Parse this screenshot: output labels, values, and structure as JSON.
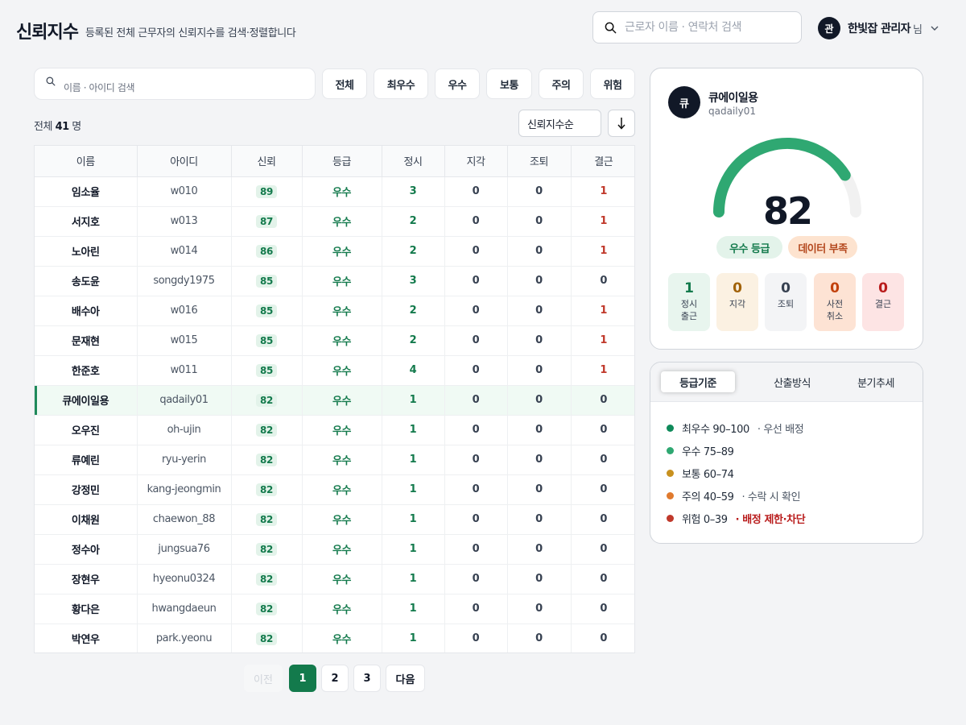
{
  "header": {
    "title": "신뢰지수",
    "subtitle": "등록된 전체 근무자의 신뢰지수를 검색·정렬합니다",
    "search_placeholder": "근로자 이름 · 연락처 검색",
    "user_avatar": "관",
    "user_name": "한빛잡 관리자",
    "user_suffix": "님"
  },
  "filters": {
    "search_placeholder": "이름 · 아이디 검색",
    "buttons": [
      "전체",
      "최우수",
      "우수",
      "보통",
      "주의",
      "위험"
    ],
    "active": "전체"
  },
  "count": {
    "prefix": "전체",
    "value": "41",
    "unit": "명"
  },
  "sort": {
    "label": "신뢰지수순",
    "direction_icon": "arrow-down-icon"
  },
  "table": {
    "columns": [
      "이름",
      "아이디",
      "신뢰",
      "등급",
      "정시",
      "지각",
      "조퇴",
      "결근"
    ],
    "rows": [
      [
        "임소율",
        "w010",
        "89",
        "우수",
        "3",
        "0",
        "0",
        "1"
      ],
      [
        "서지호",
        "w013",
        "87",
        "우수",
        "2",
        "0",
        "0",
        "1"
      ],
      [
        "노아린",
        "w014",
        "86",
        "우수",
        "2",
        "0",
        "0",
        "1"
      ],
      [
        "송도윤",
        "songdy1975",
        "85",
        "우수",
        "3",
        "0",
        "0",
        "0"
      ],
      [
        "배수아",
        "w016",
        "85",
        "우수",
        "2",
        "0",
        "0",
        "1"
      ],
      [
        "문재현",
        "w015",
        "85",
        "우수",
        "2",
        "0",
        "0",
        "1"
      ],
      [
        "한준호",
        "w011",
        "85",
        "우수",
        "4",
        "0",
        "0",
        "1"
      ],
      [
        "큐에이일용",
        "qadaily01",
        "82",
        "우수",
        "1",
        "0",
        "0",
        "0"
      ],
      [
        "오우진",
        "oh-ujin",
        "82",
        "우수",
        "1",
        "0",
        "0",
        "0"
      ],
      [
        "류예린",
        "ryu-yerin",
        "82",
        "우수",
        "1",
        "0",
        "0",
        "0"
      ],
      [
        "강정민",
        "kang-jeongmin",
        "82",
        "우수",
        "1",
        "0",
        "0",
        "0"
      ],
      [
        "이채원",
        "chaewon_88",
        "82",
        "우수",
        "1",
        "0",
        "0",
        "0"
      ],
      [
        "정수아",
        "jungsua76",
        "82",
        "우수",
        "1",
        "0",
        "0",
        "0"
      ],
      [
        "장현우",
        "hyeonu0324",
        "82",
        "우수",
        "1",
        "0",
        "0",
        "0"
      ],
      [
        "황다은",
        "hwangdaeun",
        "82",
        "우수",
        "1",
        "0",
        "0",
        "0"
      ],
      [
        "박연우",
        "park.yeonu",
        "82",
        "우수",
        "1",
        "0",
        "0",
        "0"
      ]
    ],
    "selected_id": "qadaily01"
  },
  "pagination": {
    "prev": "이전",
    "pages": [
      "1",
      "2",
      "3"
    ],
    "current": "1",
    "next": "다음"
  },
  "profile": {
    "avatar": "큐",
    "name": "큐에이일용",
    "id": "qadaily01",
    "score": "82",
    "gauge_fraction": 0.82,
    "grade_badge": "우수 등급",
    "warn_badge": "데이터 부족",
    "stats": [
      {
        "value": "1",
        "label": "정시 출근",
        "color": "#137a4c",
        "bg": "#e8f5ee"
      },
      {
        "value": "0",
        "label": "지각",
        "color": "#a16207",
        "bg": "#fbf1e2"
      },
      {
        "value": "0",
        "label": "조퇴",
        "color": "#374151",
        "bg": "#f3f4f6"
      },
      {
        "value": "0",
        "label": "사전 취소",
        "color": "#c2410c",
        "bg": "#fde3d4"
      },
      {
        "value": "0",
        "label": "결근",
        "color": "#b91c1c",
        "bg": "#fde4e4"
      }
    ]
  },
  "criteria": {
    "tabs": [
      "등급기준",
      "산출방식",
      "분기추세"
    ],
    "active_tab": "등급기준",
    "items": [
      {
        "label": "최우수 90–100",
        "note": "· 우선 배정",
        "dot": "#0f8a5a",
        "note_color": ""
      },
      {
        "label": "우수 75–89",
        "note": "",
        "dot": "#2fa872",
        "note_color": ""
      },
      {
        "label": "보통 60–74",
        "note": "",
        "dot": "#c8911f",
        "note_color": ""
      },
      {
        "label": "주의 40–59",
        "note": "· 수락 시 확인",
        "dot": "#e07a2e",
        "note_color": ""
      },
      {
        "label": "위험 0–39",
        "note": "· 배정 제한·차단",
        "dot": "#c0392b",
        "note_color": "red"
      }
    ]
  },
  "colors": {
    "accent": "#137a4c",
    "gauge_fill": "#2fa872",
    "gauge_track": "#f1f1f1"
  }
}
